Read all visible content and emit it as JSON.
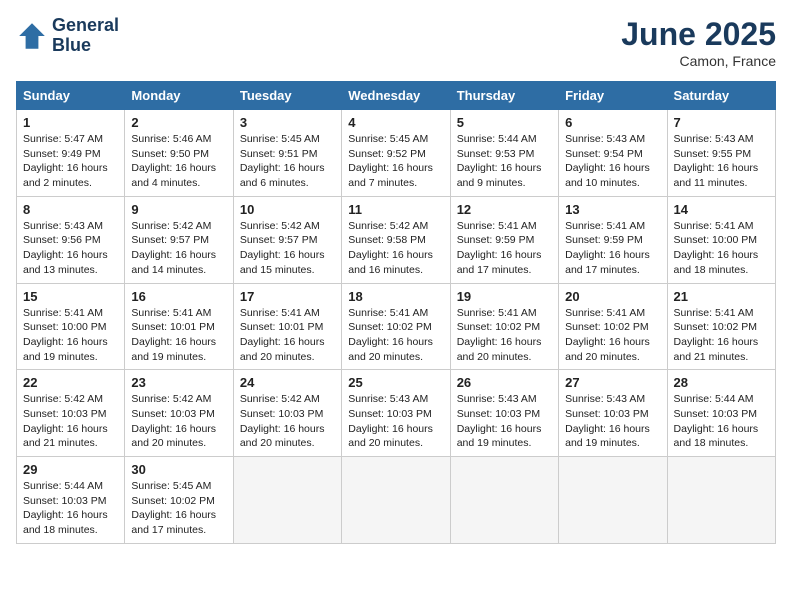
{
  "header": {
    "logo_line1": "General",
    "logo_line2": "Blue",
    "month": "June 2025",
    "location": "Camon, France"
  },
  "weekdays": [
    "Sunday",
    "Monday",
    "Tuesday",
    "Wednesday",
    "Thursday",
    "Friday",
    "Saturday"
  ],
  "weeks": [
    [
      {
        "day": "1",
        "info": "Sunrise: 5:47 AM\nSunset: 9:49 PM\nDaylight: 16 hours\nand 2 minutes."
      },
      {
        "day": "2",
        "info": "Sunrise: 5:46 AM\nSunset: 9:50 PM\nDaylight: 16 hours\nand 4 minutes."
      },
      {
        "day": "3",
        "info": "Sunrise: 5:45 AM\nSunset: 9:51 PM\nDaylight: 16 hours\nand 6 minutes."
      },
      {
        "day": "4",
        "info": "Sunrise: 5:45 AM\nSunset: 9:52 PM\nDaylight: 16 hours\nand 7 minutes."
      },
      {
        "day": "5",
        "info": "Sunrise: 5:44 AM\nSunset: 9:53 PM\nDaylight: 16 hours\nand 9 minutes."
      },
      {
        "day": "6",
        "info": "Sunrise: 5:43 AM\nSunset: 9:54 PM\nDaylight: 16 hours\nand 10 minutes."
      },
      {
        "day": "7",
        "info": "Sunrise: 5:43 AM\nSunset: 9:55 PM\nDaylight: 16 hours\nand 11 minutes."
      }
    ],
    [
      {
        "day": "8",
        "info": "Sunrise: 5:43 AM\nSunset: 9:56 PM\nDaylight: 16 hours\nand 13 minutes."
      },
      {
        "day": "9",
        "info": "Sunrise: 5:42 AM\nSunset: 9:57 PM\nDaylight: 16 hours\nand 14 minutes."
      },
      {
        "day": "10",
        "info": "Sunrise: 5:42 AM\nSunset: 9:57 PM\nDaylight: 16 hours\nand 15 minutes."
      },
      {
        "day": "11",
        "info": "Sunrise: 5:42 AM\nSunset: 9:58 PM\nDaylight: 16 hours\nand 16 minutes."
      },
      {
        "day": "12",
        "info": "Sunrise: 5:41 AM\nSunset: 9:59 PM\nDaylight: 16 hours\nand 17 minutes."
      },
      {
        "day": "13",
        "info": "Sunrise: 5:41 AM\nSunset: 9:59 PM\nDaylight: 16 hours\nand 17 minutes."
      },
      {
        "day": "14",
        "info": "Sunrise: 5:41 AM\nSunset: 10:00 PM\nDaylight: 16 hours\nand 18 minutes."
      }
    ],
    [
      {
        "day": "15",
        "info": "Sunrise: 5:41 AM\nSunset: 10:00 PM\nDaylight: 16 hours\nand 19 minutes."
      },
      {
        "day": "16",
        "info": "Sunrise: 5:41 AM\nSunset: 10:01 PM\nDaylight: 16 hours\nand 19 minutes."
      },
      {
        "day": "17",
        "info": "Sunrise: 5:41 AM\nSunset: 10:01 PM\nDaylight: 16 hours\nand 20 minutes."
      },
      {
        "day": "18",
        "info": "Sunrise: 5:41 AM\nSunset: 10:02 PM\nDaylight: 16 hours\nand 20 minutes."
      },
      {
        "day": "19",
        "info": "Sunrise: 5:41 AM\nSunset: 10:02 PM\nDaylight: 16 hours\nand 20 minutes."
      },
      {
        "day": "20",
        "info": "Sunrise: 5:41 AM\nSunset: 10:02 PM\nDaylight: 16 hours\nand 20 minutes."
      },
      {
        "day": "21",
        "info": "Sunrise: 5:41 AM\nSunset: 10:02 PM\nDaylight: 16 hours\nand 21 minutes."
      }
    ],
    [
      {
        "day": "22",
        "info": "Sunrise: 5:42 AM\nSunset: 10:03 PM\nDaylight: 16 hours\nand 21 minutes."
      },
      {
        "day": "23",
        "info": "Sunrise: 5:42 AM\nSunset: 10:03 PM\nDaylight: 16 hours\nand 20 minutes."
      },
      {
        "day": "24",
        "info": "Sunrise: 5:42 AM\nSunset: 10:03 PM\nDaylight: 16 hours\nand 20 minutes."
      },
      {
        "day": "25",
        "info": "Sunrise: 5:43 AM\nSunset: 10:03 PM\nDaylight: 16 hours\nand 20 minutes."
      },
      {
        "day": "26",
        "info": "Sunrise: 5:43 AM\nSunset: 10:03 PM\nDaylight: 16 hours\nand 19 minutes."
      },
      {
        "day": "27",
        "info": "Sunrise: 5:43 AM\nSunset: 10:03 PM\nDaylight: 16 hours\nand 19 minutes."
      },
      {
        "day": "28",
        "info": "Sunrise: 5:44 AM\nSunset: 10:03 PM\nDaylight: 16 hours\nand 18 minutes."
      }
    ],
    [
      {
        "day": "29",
        "info": "Sunrise: 5:44 AM\nSunset: 10:03 PM\nDaylight: 16 hours\nand 18 minutes."
      },
      {
        "day": "30",
        "info": "Sunrise: 5:45 AM\nSunset: 10:02 PM\nDaylight: 16 hours\nand 17 minutes."
      },
      {
        "day": "",
        "info": ""
      },
      {
        "day": "",
        "info": ""
      },
      {
        "day": "",
        "info": ""
      },
      {
        "day": "",
        "info": ""
      },
      {
        "day": "",
        "info": ""
      }
    ]
  ]
}
